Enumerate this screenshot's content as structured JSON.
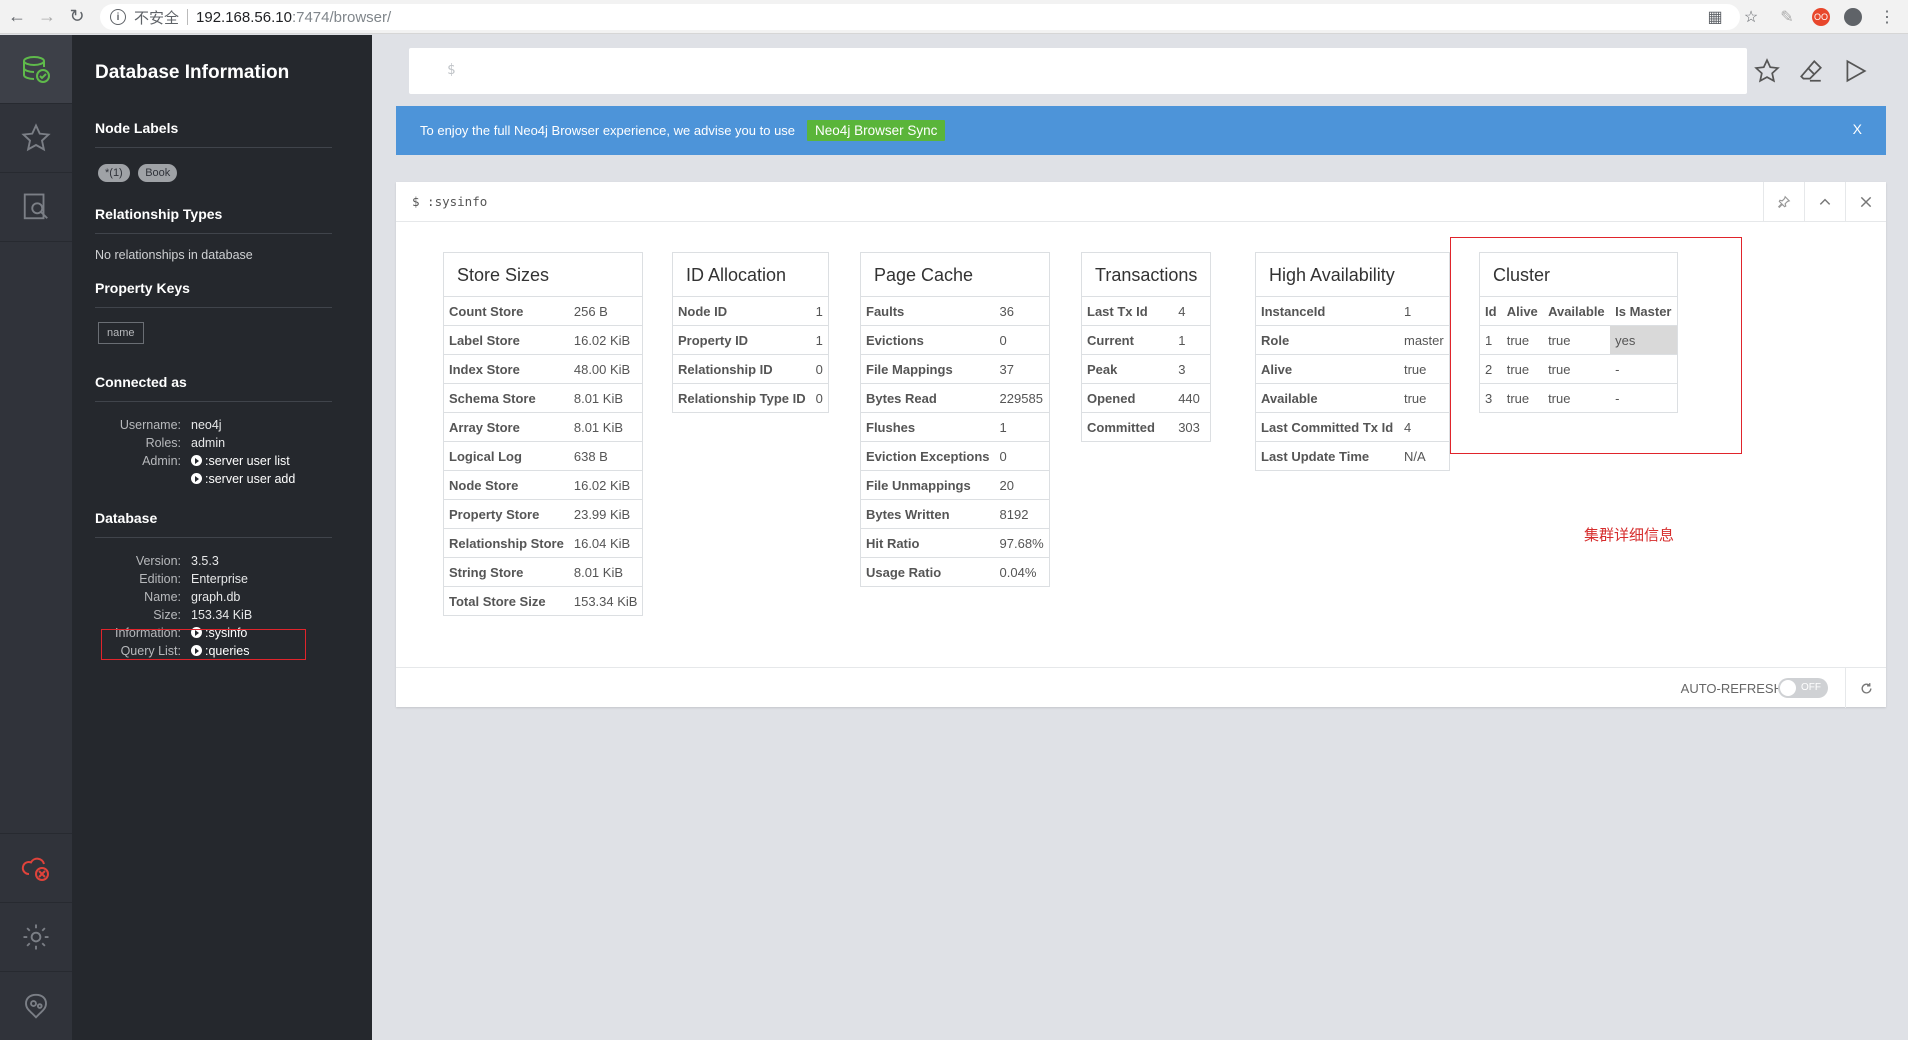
{
  "browser": {
    "insecure_label": "不安全",
    "url_host": "192.168.56.10",
    "url_path": ":7474/browser/",
    "ext_badge": "OO"
  },
  "sidebar": {
    "title": "Database Information",
    "node_labels_heading": "Node Labels",
    "node_labels": [
      "*(1)",
      "Book"
    ],
    "relationship_types_heading": "Relationship Types",
    "relationship_types_text": "No relationships in database",
    "property_keys_heading": "Property Keys",
    "property_keys": [
      "name"
    ],
    "connected_heading": "Connected as",
    "connected": {
      "username_label": "Username:",
      "username": "neo4j",
      "roles_label": "Roles:",
      "roles": "admin",
      "admin_label": "Admin:",
      "admin_cmd1": ":server user list",
      "admin_cmd2": ":server user add"
    },
    "database_heading": "Database",
    "database": {
      "version_label": "Version:",
      "version": "3.5.3",
      "edition_label": "Edition:",
      "edition": "Enterprise",
      "name_label": "Name:",
      "name": "graph.db",
      "size_label": "Size:",
      "size": "153.34 KiB",
      "information_label": "Information:",
      "information_cmd": ":sysinfo",
      "querylist_label": "Query List:",
      "querylist_cmd": ":queries"
    }
  },
  "editor": {
    "prompt": "$"
  },
  "banner": {
    "text": "To enjoy the full Neo4j Browser experience, we advise you to use",
    "button": "Neo4j Browser Sync",
    "close": "X"
  },
  "frame": {
    "command": "$ :sysinfo",
    "auto_refresh_label": "AUTO-REFRESH",
    "toggle_label": "OFF",
    "annotation": "集群详细信息"
  },
  "store_sizes": {
    "title": "Store Sizes",
    "rows": [
      [
        "Count Store",
        "256 B"
      ],
      [
        "Label Store",
        "16.02 KiB"
      ],
      [
        "Index Store",
        "48.00 KiB"
      ],
      [
        "Schema Store",
        "8.01 KiB"
      ],
      [
        "Array Store",
        "8.01 KiB"
      ],
      [
        "Logical Log",
        "638 B"
      ],
      [
        "Node Store",
        "16.02 KiB"
      ],
      [
        "Property Store",
        "23.99 KiB"
      ],
      [
        "Relationship Store",
        "16.04 KiB"
      ],
      [
        "String Store",
        "8.01 KiB"
      ],
      [
        "Total Store Size",
        "153.34 KiB"
      ]
    ]
  },
  "id_allocation": {
    "title": "ID Allocation",
    "rows": [
      [
        "Node ID",
        "1"
      ],
      [
        "Property ID",
        "1"
      ],
      [
        "Relationship ID",
        "0"
      ],
      [
        "Relationship Type ID",
        "0"
      ]
    ]
  },
  "page_cache": {
    "title": "Page Cache",
    "rows": [
      [
        "Faults",
        "36"
      ],
      [
        "Evictions",
        "0"
      ],
      [
        "File Mappings",
        "37"
      ],
      [
        "Bytes Read",
        "229585"
      ],
      [
        "Flushes",
        "1"
      ],
      [
        "Eviction Exceptions",
        "0"
      ],
      [
        "File Unmappings",
        "20"
      ],
      [
        "Bytes Written",
        "8192"
      ],
      [
        "Hit Ratio",
        "97.68%"
      ],
      [
        "Usage Ratio",
        "0.04%"
      ]
    ]
  },
  "transactions": {
    "title": "Transactions",
    "rows": [
      [
        "Last Tx Id",
        "4"
      ],
      [
        "Current",
        "1"
      ],
      [
        "Peak",
        "3"
      ],
      [
        "Opened",
        "440"
      ],
      [
        "Committed",
        "303"
      ]
    ]
  },
  "high_availability": {
    "title": "High Availability",
    "rows": [
      [
        "InstanceId",
        "1"
      ],
      [
        "Role",
        "master"
      ],
      [
        "Alive",
        "true"
      ],
      [
        "Available",
        "true"
      ],
      [
        "Last Committed Tx Id",
        "4"
      ],
      [
        "Last Update Time",
        "N/A"
      ]
    ]
  },
  "cluster": {
    "title": "Cluster",
    "headers": [
      "Id",
      "Alive",
      "Available",
      "Is Master"
    ],
    "rows": [
      [
        "1",
        "true",
        "true",
        "yes"
      ],
      [
        "2",
        "true",
        "true",
        "-"
      ],
      [
        "3",
        "true",
        "true",
        "-"
      ]
    ]
  }
}
